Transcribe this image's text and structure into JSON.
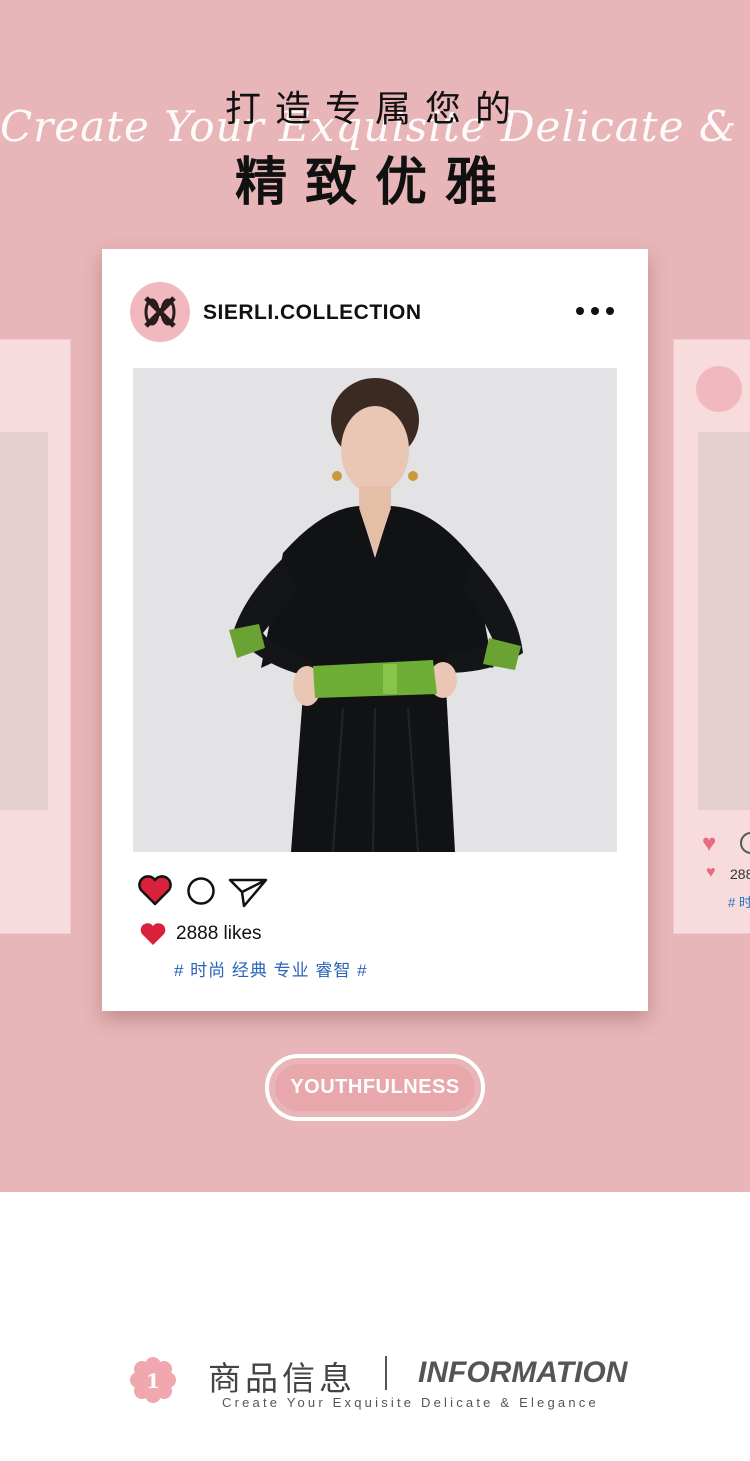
{
  "hero": {
    "title_top": "打造专属您的",
    "script_text": "Create Your Exquisite Delicate & Elegance",
    "title_main": "精致优雅",
    "bg_color": "#e8b6b8"
  },
  "post": {
    "account_name": "SIERLI.COLLECTION",
    "more_icon": "more-dots-icon",
    "likes_text": "2888 likes",
    "tags_text": "# 时尚 经典 专业 睿智 #",
    "tag_color": "#2b63b8",
    "heart_color": "#d9213c"
  },
  "side_card_right": {
    "likes_partial": "288",
    "tags_partial": "# 时"
  },
  "badge": {
    "label": "YOUTHFULNESS",
    "color": "#e8a7ab"
  },
  "footer": {
    "number": "1",
    "title_cn": "商品信息",
    "separator": "|",
    "title_en": "INFORMATION",
    "subtitle": "Create Your Exquisite Delicate & Elegance"
  }
}
